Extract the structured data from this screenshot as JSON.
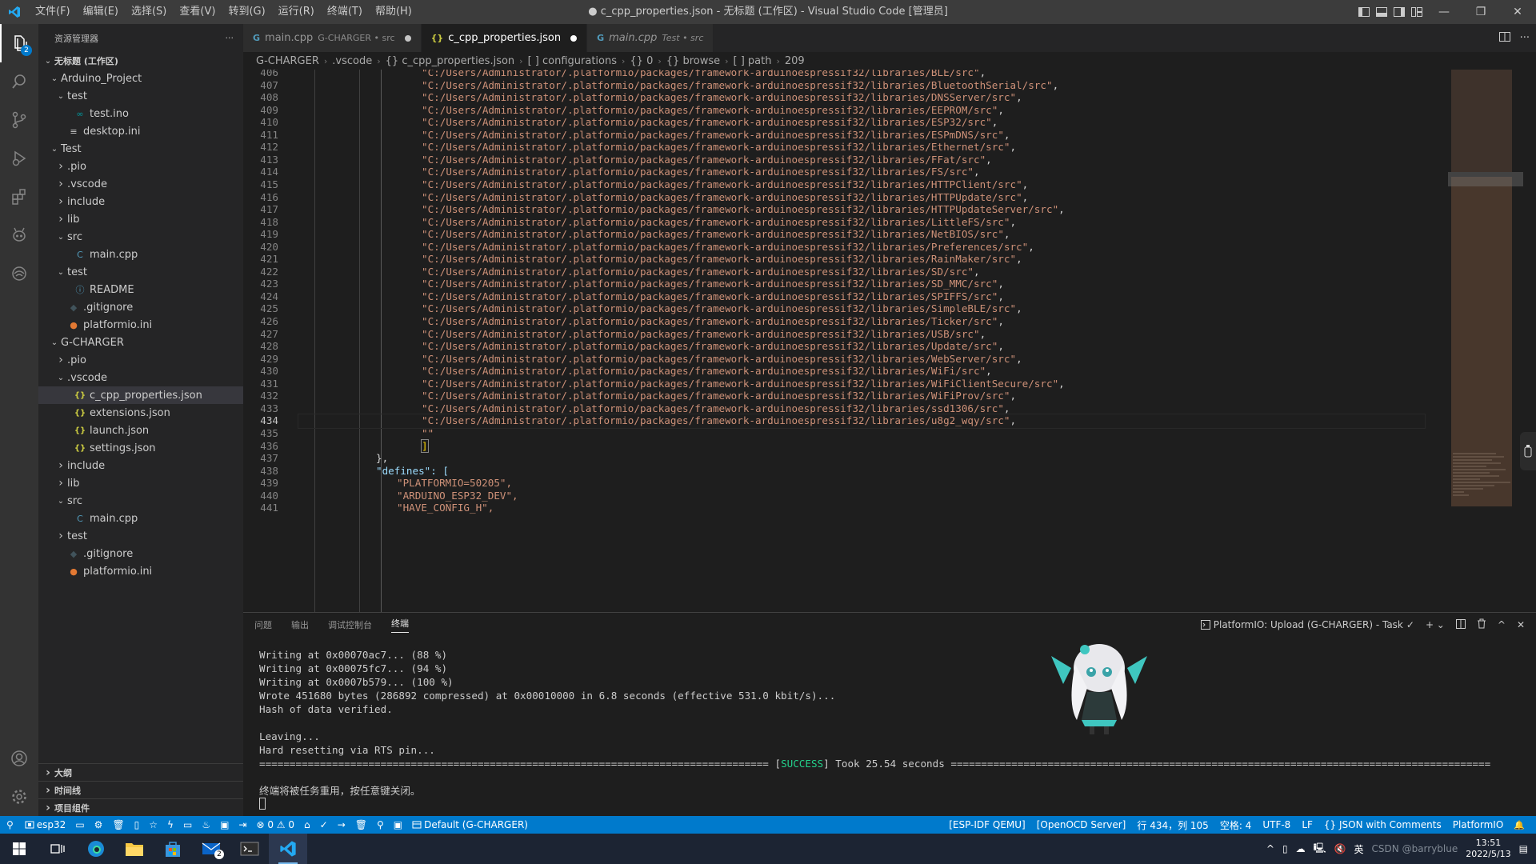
{
  "window": {
    "title": "● c_cpp_properties.json - 无标题 (工作区) - Visual Studio Code [管理员]",
    "menu": [
      "文件(F)",
      "编辑(E)",
      "选择(S)",
      "查看(V)",
      "转到(G)",
      "运行(R)",
      "终端(T)",
      "帮助(H)"
    ]
  },
  "activity": {
    "badge": "2"
  },
  "sidebar": {
    "title": "资源管理器",
    "more": "···",
    "tree": [
      {
        "label": "无标题 (工作区)",
        "depth": 0,
        "chev": "v",
        "icon": "",
        "bold": true
      },
      {
        "label": "Arduino_Project",
        "depth": 1,
        "chev": "v",
        "icon": ""
      },
      {
        "label": "test",
        "depth": 2,
        "chev": "v",
        "icon": ""
      },
      {
        "label": "test.ino",
        "depth": 3,
        "chev": "",
        "icon": "arduino-icon"
      },
      {
        "label": "desktop.ini",
        "depth": 2,
        "chev": "",
        "icon": "ini-icon"
      },
      {
        "label": "Test",
        "depth": 1,
        "chev": "v",
        "icon": ""
      },
      {
        "label": ".pio",
        "depth": 2,
        "chev": ">",
        "icon": ""
      },
      {
        "label": ".vscode",
        "depth": 2,
        "chev": ">",
        "icon": ""
      },
      {
        "label": "include",
        "depth": 2,
        "chev": ">",
        "icon": ""
      },
      {
        "label": "lib",
        "depth": 2,
        "chev": ">",
        "icon": ""
      },
      {
        "label": "src",
        "depth": 2,
        "chev": "v",
        "icon": ""
      },
      {
        "label": "main.cpp",
        "depth": 3,
        "chev": "",
        "icon": "cpp-icon"
      },
      {
        "label": "test",
        "depth": 2,
        "chev": "v",
        "icon": ""
      },
      {
        "label": "README",
        "depth": 3,
        "chev": "",
        "icon": "info-icon"
      },
      {
        "label": ".gitignore",
        "depth": 2,
        "chev": "",
        "icon": "git-icon"
      },
      {
        "label": "platformio.ini",
        "depth": 2,
        "chev": "",
        "icon": "platformio-icon"
      },
      {
        "label": "G-CHARGER",
        "depth": 1,
        "chev": "v",
        "icon": ""
      },
      {
        "label": ".pio",
        "depth": 2,
        "chev": ">",
        "icon": ""
      },
      {
        "label": ".vscode",
        "depth": 2,
        "chev": "v",
        "icon": ""
      },
      {
        "label": "c_cpp_properties.json",
        "depth": 3,
        "chev": "",
        "icon": "json-icon",
        "selected": true
      },
      {
        "label": "extensions.json",
        "depth": 3,
        "chev": "",
        "icon": "json-icon"
      },
      {
        "label": "launch.json",
        "depth": 3,
        "chev": "",
        "icon": "json-icon"
      },
      {
        "label": "settings.json",
        "depth": 3,
        "chev": "",
        "icon": "json-icon"
      },
      {
        "label": "include",
        "depth": 2,
        "chev": ">",
        "icon": ""
      },
      {
        "label": "lib",
        "depth": 2,
        "chev": ">",
        "icon": ""
      },
      {
        "label": "src",
        "depth": 2,
        "chev": "v",
        "icon": ""
      },
      {
        "label": "main.cpp",
        "depth": 3,
        "chev": "",
        "icon": "cpp-icon"
      },
      {
        "label": "test",
        "depth": 2,
        "chev": ">",
        "icon": ""
      },
      {
        "label": ".gitignore",
        "depth": 2,
        "chev": "",
        "icon": "git-icon"
      },
      {
        "label": "platformio.ini",
        "depth": 2,
        "chev": "",
        "icon": "platformio-icon"
      }
    ],
    "sections": [
      "大纲",
      "时间线",
      "项目组件"
    ]
  },
  "tabs": [
    {
      "name": "main.cpp",
      "desc": "G-CHARGER • src",
      "active": false,
      "italic": false,
      "dirty": true,
      "icon": "cpp"
    },
    {
      "name": "c_cpp_properties.json",
      "desc": "",
      "active": true,
      "italic": false,
      "dirty": true,
      "icon": "json"
    },
    {
      "name": "main.cpp",
      "desc": "Test • src",
      "active": false,
      "italic": true,
      "dirty": false,
      "icon": "cpp"
    }
  ],
  "breadcrumb": [
    "G-CHARGER",
    ".vscode",
    "{} c_cpp_properties.json",
    "[ ] configurations",
    "{} 0",
    "{} browse",
    "[ ] path",
    "209"
  ],
  "code": {
    "path_prefix": "\"C:/Users/Administrator/.platformio/packages/framework-arduinoespressif32/libraries/",
    "lines": [
      {
        "n": "406",
        "lib": "BLE/src"
      },
      {
        "n": "407",
        "lib": "BluetoothSerial/src"
      },
      {
        "n": "408",
        "lib": "DNSServer/src"
      },
      {
        "n": "409",
        "lib": "EEPROM/src"
      },
      {
        "n": "410",
        "lib": "ESP32/src"
      },
      {
        "n": "411",
        "lib": "ESPmDNS/src"
      },
      {
        "n": "412",
        "lib": "Ethernet/src"
      },
      {
        "n": "413",
        "lib": "FFat/src"
      },
      {
        "n": "414",
        "lib": "FS/src"
      },
      {
        "n": "415",
        "lib": "HTTPClient/src"
      },
      {
        "n": "416",
        "lib": "HTTPUpdate/src"
      },
      {
        "n": "417",
        "lib": "HTTPUpdateServer/src"
      },
      {
        "n": "418",
        "lib": "LittleFS/src"
      },
      {
        "n": "419",
        "lib": "NetBIOS/src"
      },
      {
        "n": "420",
        "lib": "Preferences/src"
      },
      {
        "n": "421",
        "lib": "RainMaker/src"
      },
      {
        "n": "422",
        "lib": "SD/src"
      },
      {
        "n": "423",
        "lib": "SD_MMC/src"
      },
      {
        "n": "424",
        "lib": "SPIFFS/src"
      },
      {
        "n": "425",
        "lib": "SimpleBLE/src"
      },
      {
        "n": "426",
        "lib": "Ticker/src"
      },
      {
        "n": "427",
        "lib": "USB/src"
      },
      {
        "n": "428",
        "lib": "Update/src"
      },
      {
        "n": "429",
        "lib": "WebServer/src"
      },
      {
        "n": "430",
        "lib": "WiFi/src"
      },
      {
        "n": "431",
        "lib": "WiFiClientSecure/src"
      },
      {
        "n": "432",
        "lib": "WiFiProv/src"
      },
      {
        "n": "433",
        "lib": "ssd1306/src"
      },
      {
        "n": "434",
        "lib": "u8g2_wqy/src"
      }
    ],
    "tail": [
      {
        "n": "435",
        "text": "\"\""
      },
      {
        "n": "436",
        "text": "]"
      },
      {
        "n": "437",
        "text": "},"
      },
      {
        "n": "438",
        "text": "\"defines\": ["
      },
      {
        "n": "439",
        "text": "\"PLATFORMIO=50205\","
      },
      {
        "n": "440",
        "text": "\"ARDUINO_ESP32_DEV\","
      },
      {
        "n": "441",
        "text": "\"HAVE_CONFIG_H\","
      }
    ],
    "current_line": "434"
  },
  "panel": {
    "tabs": [
      "问题",
      "输出",
      "调试控制台",
      "终端"
    ],
    "task": "PlatformIO: Upload (G-CHARGER) - Task",
    "terminal": [
      "Writing at 0x00070ac7... (88 %)",
      "Writing at 0x00075fc7... (94 %)",
      "Writing at 0x0007b579... (100 %)",
      "Wrote 451680 bytes (286892 compressed) at 0x00010000 in 6.8 seconds (effective 531.0 kbit/s)...",
      "Hash of data verified.",
      "",
      "Leaving...",
      "Hard resetting via RTS pin..."
    ],
    "success_left": "==================================================================================== [",
    "success_word": "SUCCESS",
    "success_right": "] Took 25.54 seconds =========================================================================================",
    "reuse_msg": "终端将被任务重用，按任意键关闭。"
  },
  "status": {
    "left": [
      "esp32",
      "⊗ 0 ⚠ 0",
      "Default (G-CHARGER)"
    ],
    "right": [
      "[ESP-IDF QEMU]",
      "[OpenOCD Server]",
      "行 434，列 105",
      "空格: 4",
      "UTF-8",
      "LF",
      "{} JSON with Comments",
      "PlatformIO"
    ]
  },
  "taskbar": {
    "tray_text": "英",
    "watermark": "CSDN @barryblue",
    "time": "13:51",
    "date": "2022/5/13",
    "mail_badge": "2"
  },
  "colors": {
    "accent": "#007acc",
    "string": "#ce9178",
    "key": "#9cdcfe",
    "success": "#23d18b"
  }
}
